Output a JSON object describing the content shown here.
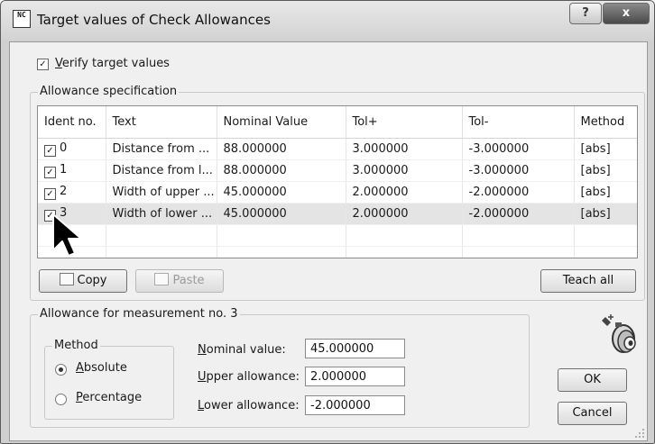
{
  "window": {
    "title": "Target values of Check Allowances",
    "app_icon_text": "NC",
    "help_label": "?",
    "close_label": "x"
  },
  "verify": {
    "label": "Verify target values",
    "checked": true
  },
  "allowance_spec": {
    "title": "Allowance specification",
    "columns": [
      "Ident no.",
      "Text",
      "Nominal Value",
      "Tol+",
      "Tol-",
      "Method"
    ],
    "rows": [
      {
        "checked": true,
        "ident": "0",
        "text": "Distance from ...",
        "nominal": "88.000000",
        "tol_plus": "3.000000",
        "tol_minus": "-3.000000",
        "method": "[abs]"
      },
      {
        "checked": true,
        "ident": "1",
        "text": "Distance from l...",
        "nominal": "88.000000",
        "tol_plus": "3.000000",
        "tol_minus": "-3.000000",
        "method": "[abs]"
      },
      {
        "checked": true,
        "ident": "2",
        "text": "Width of upper ...",
        "nominal": "45.000000",
        "tol_plus": "2.000000",
        "tol_minus": "-2.000000",
        "method": "[abs]"
      },
      {
        "checked": true,
        "ident": "3",
        "text": "Width of lower ...",
        "nominal": "45.000000",
        "tol_plus": "2.000000",
        "tol_minus": "-2.000000",
        "method": "[abs]"
      }
    ],
    "selected_row": 3
  },
  "buttons": {
    "copy": "Copy",
    "paste": "Paste",
    "teach_all": "Teach all",
    "ok": "OK",
    "cancel": "Cancel"
  },
  "measurement": {
    "title": "Allowance for measurement no. 3",
    "method_title": "Method",
    "absolute_label": "Absolute",
    "percentage_label": "Percentage",
    "selected_method": "Absolute",
    "nominal_label": "Nominal value:",
    "nominal_value": "45.000000",
    "upper_label": "Upper allowance:",
    "upper_value": "2.000000",
    "lower_label": "Lower allowance:",
    "lower_value": "-2.000000"
  }
}
